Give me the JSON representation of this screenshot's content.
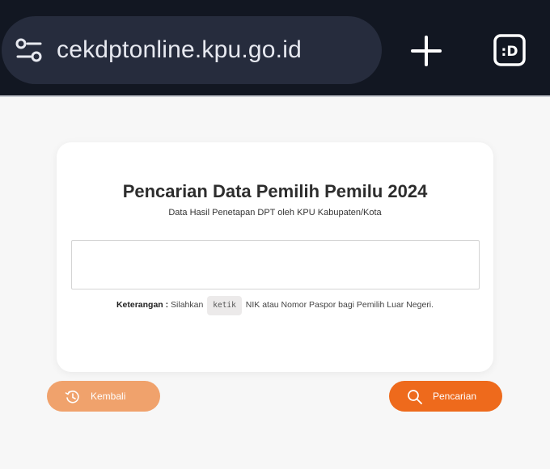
{
  "browser": {
    "url": "cekdptonline.kpu.go.id",
    "tabs_badge": ":D",
    "bar_color": "#121722"
  },
  "card": {
    "title": "Pencarian Data Pemilih Pemilu 2024",
    "subtitle": "Data Hasil Penetapan DPT oleh KPU Kabupaten/Kota",
    "search_value": "",
    "note_label": "Keterangan :",
    "note_before": "Silahkan",
    "note_kbd": "ketik",
    "note_after": "NIK atau Nomor Paspor bagi Pemilih Luar Negeri."
  },
  "actions": {
    "back_label": "Kembali",
    "search_label": "Pencarian",
    "back_color": "#f0a26c",
    "search_color": "#ee6a1c"
  },
  "icons": {
    "site_settings": "tune-icon",
    "new_tab": "plus-icon",
    "tabs": "tab-switcher-icon",
    "back": "history-icon",
    "search": "search-icon"
  }
}
